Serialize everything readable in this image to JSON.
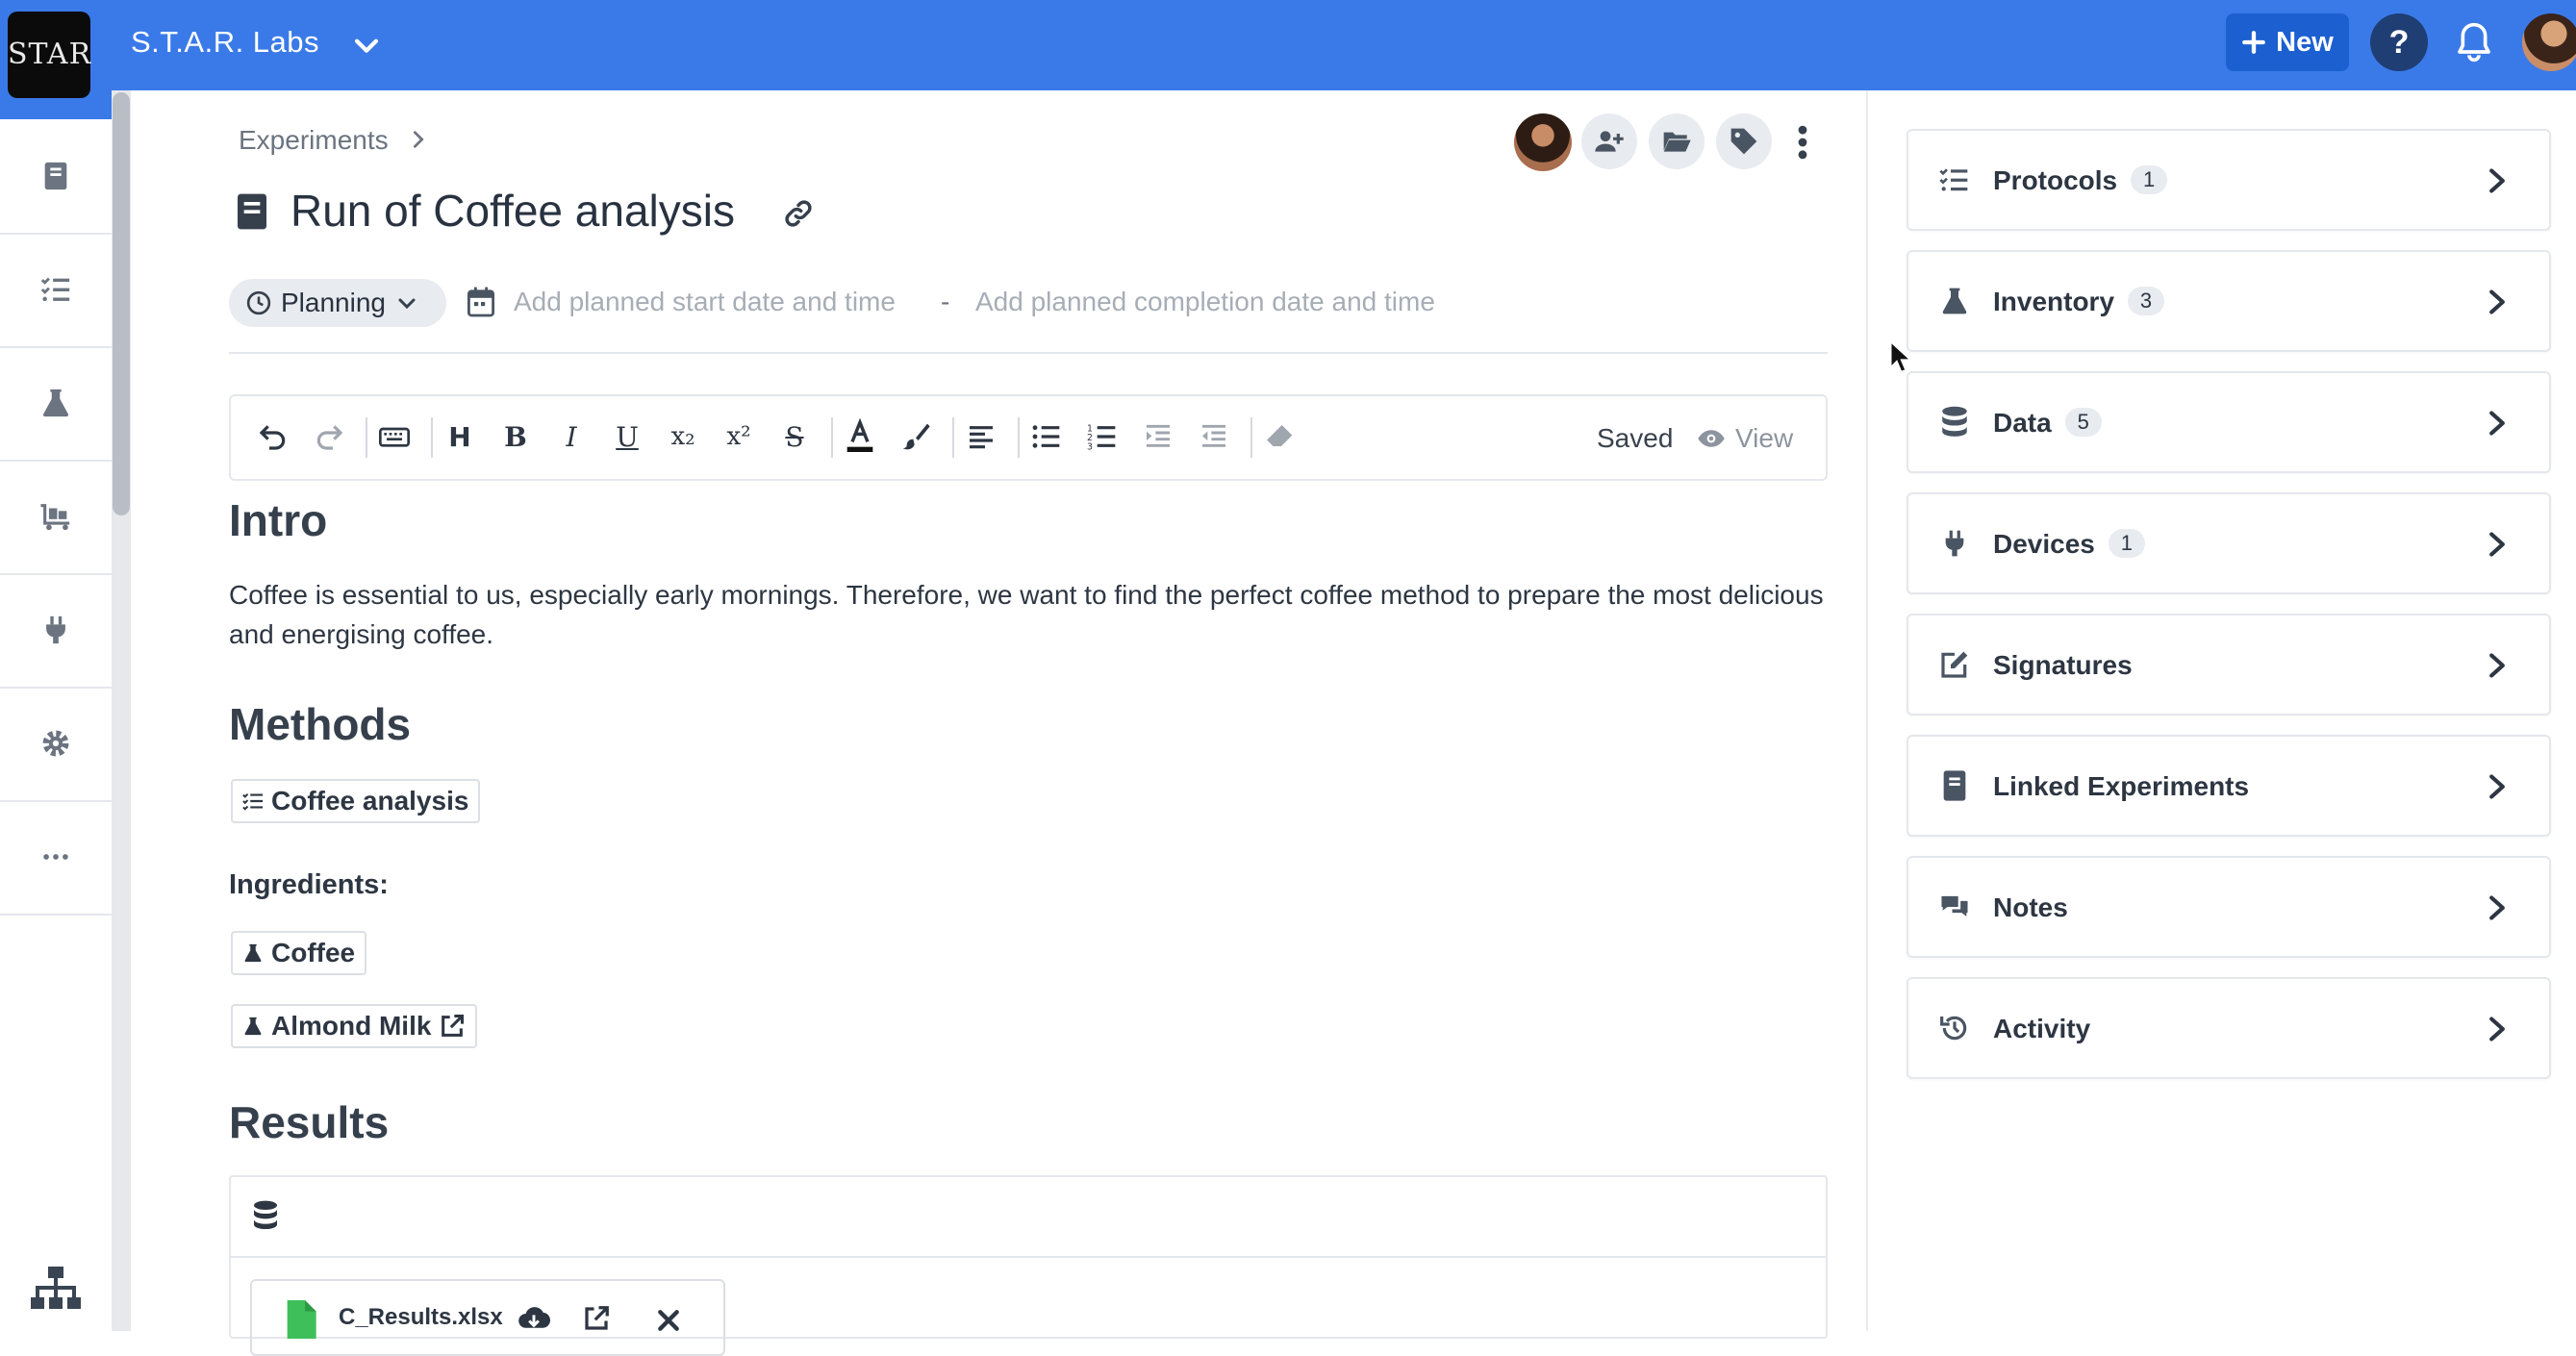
{
  "header": {
    "logo_text": "STAR",
    "workspace": "S.T.A.R. Labs",
    "new_label": "New",
    "help_label": "?"
  },
  "colors": {
    "primary": "#3a7ae8",
    "new_button": "#1b5fd0",
    "help_button": "#1f3e74"
  },
  "left_nav": [
    "notebook-icon",
    "protocols-icon",
    "inventory-flask-icon",
    "equipment-icon",
    "devices-plug-icon",
    "settings-gear-icon",
    "more-icon",
    "hierarchy-icon"
  ],
  "experiment": {
    "breadcrumb": "Experiments",
    "title": "Run of Coffee analysis",
    "status": "Planning",
    "start_placeholder": "Add planned start date and time",
    "date_separator": "-",
    "end_placeholder": "Add planned completion date and time"
  },
  "editor": {
    "saved_label": "Saved",
    "view_label": "View",
    "toolbar": {
      "heading": "H",
      "bold": "B",
      "italic": "I",
      "underline": "U",
      "subscript": "x₂",
      "superscript": "x²",
      "strike": "S"
    },
    "intro_heading": "Intro",
    "intro_text": "Coffee is essential to us, especially early mornings. Therefore, we want to find the perfect coffee method to prepare the most delicious and energising coffee.",
    "methods_heading": "Methods",
    "protocol_chip": "Coffee analysis",
    "ingredients_heading": "Ingredients:",
    "ingredient_1": "Coffee",
    "ingredient_2": "Almond Milk",
    "results_heading": "Results",
    "file_name": "C_Results.xlsx"
  },
  "right_panel": [
    {
      "label": "Protocols",
      "count": "1",
      "icon": "list-check-icon"
    },
    {
      "label": "Inventory",
      "count": "3",
      "icon": "flask-icon"
    },
    {
      "label": "Data",
      "count": "5",
      "icon": "database-icon"
    },
    {
      "label": "Devices",
      "count": "1",
      "icon": "plug-icon"
    },
    {
      "label": "Signatures",
      "count": "",
      "icon": "signature-icon"
    },
    {
      "label": "Linked Experiments",
      "count": "",
      "icon": "notebook-icon"
    },
    {
      "label": "Notes",
      "count": "",
      "icon": "comments-icon"
    },
    {
      "label": "Activity",
      "count": "",
      "icon": "history-icon"
    }
  ]
}
